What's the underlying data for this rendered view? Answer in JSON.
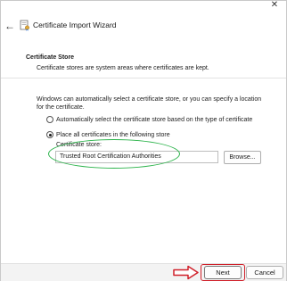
{
  "window": {
    "close_glyph": "✕",
    "back_glyph": "←",
    "title": "Certificate Import Wizard",
    "icon": "certificate-wizard-icon"
  },
  "section": {
    "header": "Certificate Store",
    "subtitle": "Certificate stores are system areas where certificates are kept."
  },
  "description": "Windows can automatically select a certificate store, or you can specify a location for the certificate.",
  "options": [
    {
      "label": "Automatically select the certificate store based on the type of certificate",
      "selected": false
    },
    {
      "label": "Place all certificates in the following store",
      "selected": true
    }
  ],
  "store": {
    "label": "Certificate store:",
    "value": "Trusted Root Certification Authorities",
    "browse_label": "Browse..."
  },
  "footer": {
    "next_label": "Next",
    "cancel_label": "Cancel"
  },
  "annotations": {
    "ellipse_color": "#2bb34a",
    "highlight_color": "#d0202a"
  }
}
